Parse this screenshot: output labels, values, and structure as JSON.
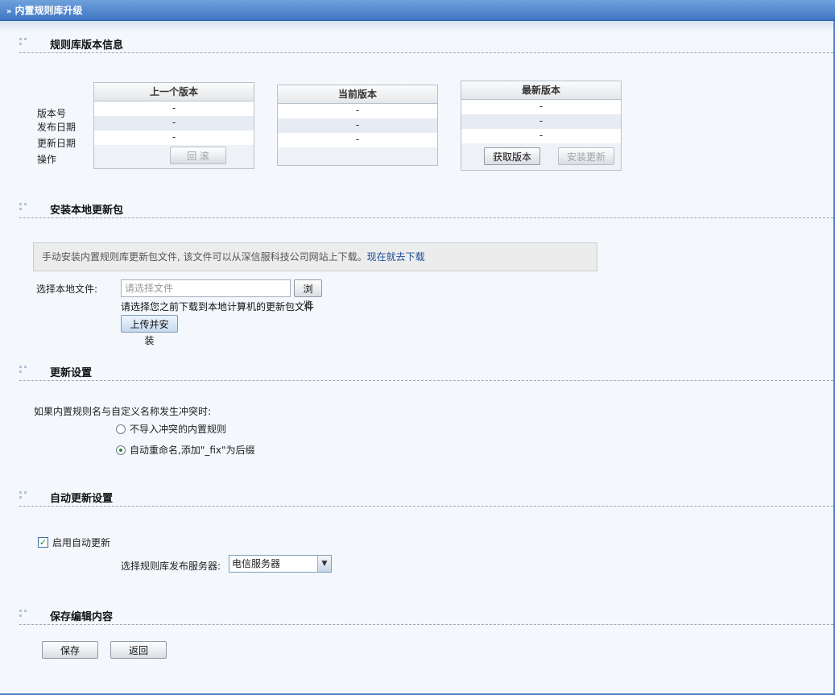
{
  "window": {
    "title": "内置规则库升级"
  },
  "sections": {
    "version_info": "规则库版本信息",
    "local_update": "安装本地更新包",
    "update_settings": "更新设置",
    "auto_update": "自动更新设置",
    "save": "保存编辑内容"
  },
  "version_table": {
    "row_labels": [
      "版本号",
      "发布日期",
      "更新日期",
      "操作"
    ],
    "previous": {
      "header": "上一个版本",
      "values": [
        "-",
        "-",
        "-"
      ],
      "rollback_button": "回 滚"
    },
    "current": {
      "header": "当前版本",
      "values": [
        "-",
        "-",
        "-"
      ]
    },
    "latest": {
      "header": "最新版本",
      "values": [
        "-",
        "-",
        "-"
      ],
      "fetch_button": "获取版本",
      "install_button": "安装更新"
    }
  },
  "local_update": {
    "notice": "手动安装内置规则库更新包文件, 该文件可以从深信服科技公司网站上下载。",
    "download_link": "现在就去下载",
    "file_label": "选择本地文件:",
    "file_placeholder": "请选择文件",
    "browse_button": "浏览",
    "hint": "请选择您之前下载到本地计算机的更新包文件",
    "upload_button": "上传并安装"
  },
  "update_settings": {
    "conflict_question": "如果内置规则名与自定义名称发生冲突时:",
    "option_skip": "不导入冲突的内置规则",
    "option_rename": "自动重命名,添加\"_fix\"为后缀",
    "selected": "option_rename"
  },
  "auto_update": {
    "enable_label": "启用自动更新",
    "enabled": true,
    "server_label": "选择规则库发布服务器:",
    "server_value": "电信服务器"
  },
  "actions": {
    "save_button": "保存",
    "back_button": "返回"
  },
  "colors": {
    "titlebar": "#4a80cc",
    "link": "#1e4f9a",
    "radio_dot": "#1f8b2c"
  }
}
